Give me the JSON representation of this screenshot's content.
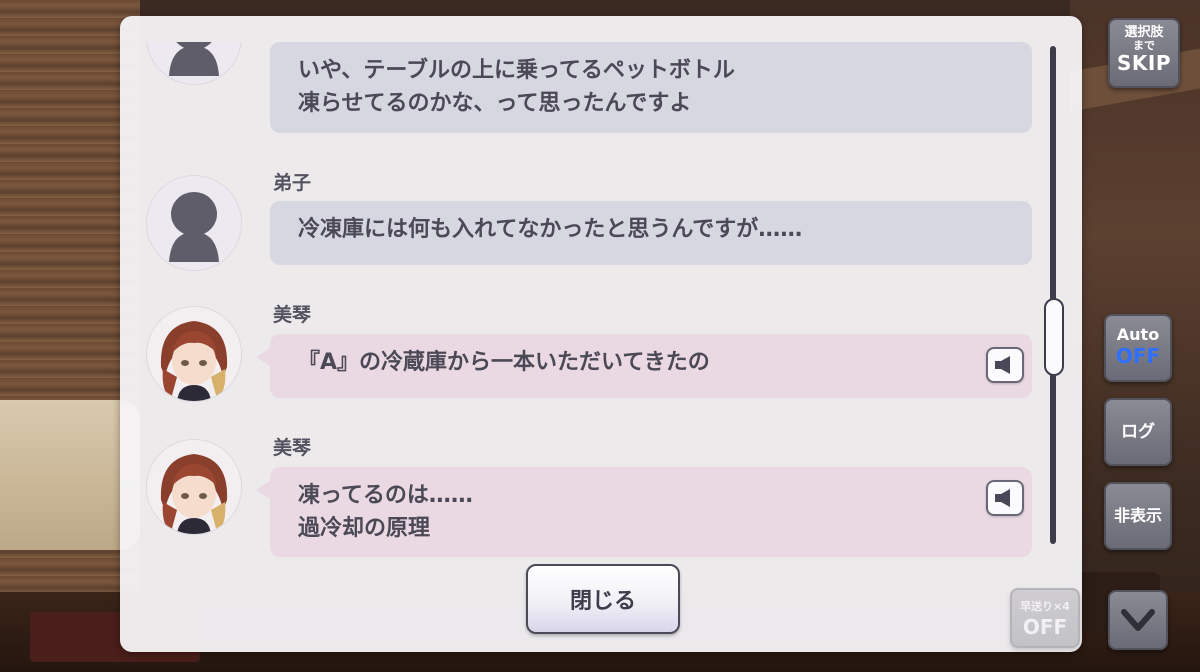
{
  "log": {
    "entries": [
      {
        "speaker": "",
        "avatar": "silhouette",
        "bubble_style": "gray",
        "lines": [
          "いや、テーブルの上に乗ってるペットボトル",
          "凍らせてるのかな、って思ったんですよ"
        ],
        "voice": false
      },
      {
        "speaker": "弟子",
        "avatar": "silhouette",
        "bubble_style": "gray",
        "lines": [
          "冷凍庫には何も入れてなかったと思うんですが……"
        ],
        "voice": false
      },
      {
        "speaker": "美琴",
        "avatar": "mikoto-portrait",
        "bubble_style": "pink",
        "lines": [
          "『A』の冷蔵庫から一本いただいてきたの"
        ],
        "voice": true
      },
      {
        "speaker": "美琴",
        "avatar": "mikoto-portrait",
        "bubble_style": "pink",
        "lines": [
          "凍ってるのは……",
          "過冷却の原理"
        ],
        "voice": true
      }
    ],
    "scroll_position": 0.6
  },
  "close_label": "閉じる",
  "controls": {
    "skip": {
      "line1": "選択肢",
      "line2": "まで",
      "line3": "SKIP"
    },
    "auto": {
      "label": "Auto",
      "state": "OFF"
    },
    "log": "ログ",
    "hide": "非表示",
    "fast_forward": {
      "label": "早送り×4",
      "state": "OFF"
    }
  },
  "colors": {
    "bubble_gray": "#d6d7e1",
    "bubble_pink": "#ead9e3",
    "text": "#4b4956",
    "auto_off": "#2f6fff"
  },
  "icons": [
    "speaker-icon",
    "chevron-down-icon",
    "silhouette-avatar",
    "character-portrait"
  ]
}
